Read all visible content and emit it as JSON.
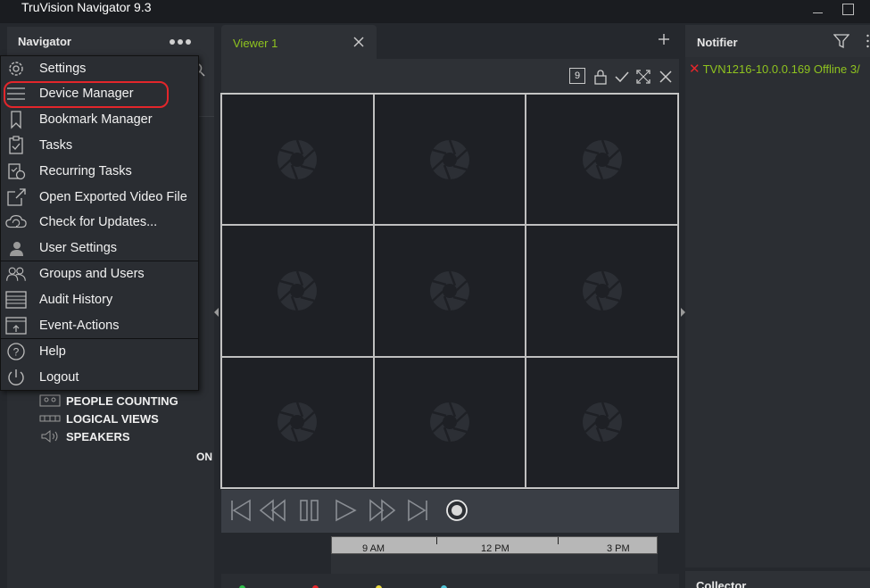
{
  "window": {
    "title": "TruVision Navigator 9.3"
  },
  "navigator": {
    "title": "Navigator",
    "tree_partial": "ON",
    "tree_items": [
      {
        "label": "PEOPLE COUNTING",
        "icon": "people-counting-icon"
      },
      {
        "label": "LOGICAL VIEWS",
        "icon": "logical-views-icon"
      },
      {
        "label": "SPEAKERS",
        "icon": "speaker-icon"
      }
    ]
  },
  "menu": {
    "items": [
      {
        "label": "Settings",
        "icon": "gear-icon"
      },
      {
        "label": "Device Manager",
        "icon": "list-icon"
      },
      {
        "label": "Bookmark Manager",
        "icon": "bookmark-icon"
      },
      {
        "label": "Tasks",
        "icon": "clipboard-check-icon"
      },
      {
        "label": "Recurring Tasks",
        "icon": "recurring-tasks-icon"
      },
      {
        "label": "Open Exported Video File",
        "icon": "open-external-icon"
      },
      {
        "label": "Check for Updates...",
        "icon": "cloud-refresh-icon"
      },
      {
        "label": "User Settings",
        "icon": "user-icon"
      },
      {
        "label": "Groups and Users",
        "icon": "users-group-icon"
      },
      {
        "label": "Audit History",
        "icon": "audit-table-icon"
      },
      {
        "label": "Event-Actions",
        "icon": "event-actions-icon"
      },
      {
        "label": "Help",
        "icon": "help-icon"
      },
      {
        "label": "Logout",
        "icon": "power-icon"
      }
    ]
  },
  "viewer": {
    "tab_label": "Viewer 1",
    "layout_count": "9",
    "cells": 9
  },
  "timeline": {
    "labels": [
      "9 AM",
      "12 PM",
      "3 PM"
    ]
  },
  "notifier": {
    "title": "Notifier",
    "entry": "TVN1216-10.0.0.169 Offline  3/"
  },
  "collector": {
    "title": "Collector"
  },
  "colors": {
    "accent_green": "#8fc31f",
    "error_red": "#e5262b",
    "highlight_red": "#e3262b"
  }
}
